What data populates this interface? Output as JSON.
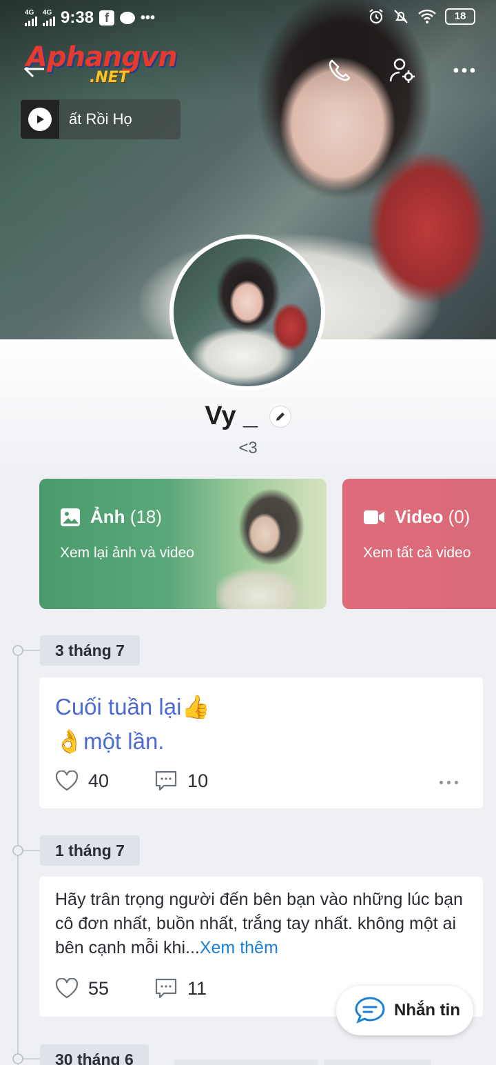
{
  "status_bar": {
    "network1": "4G",
    "network2": "4G",
    "time": "9:38",
    "battery": "18"
  },
  "watermark": {
    "brand_main": "Aphangvn",
    "brand_sub": ".NET"
  },
  "music": {
    "text": "ất Rồi     Họ"
  },
  "profile": {
    "name": "Vy _",
    "status": "<3"
  },
  "media": {
    "photo": {
      "label": "Ảnh",
      "count": "(18)",
      "subtitle": "Xem lại ảnh và video"
    },
    "video": {
      "label": "Video",
      "count": "(0)",
      "subtitle": "Xem tất cả video"
    }
  },
  "posts": [
    {
      "date": "3 tháng 7",
      "line1": "Cuối tuần lại👍",
      "line2": "👌một lần.",
      "likes": "40",
      "comments": "10"
    },
    {
      "date": "1 tháng 7",
      "text": "Hãy trân trọng người đến bên bạn vào những lúc bạn cô đơn nhất, buồn nhất, trắng tay nhất. không một ai bên cạnh mỗi khi...",
      "more": "Xem thêm",
      "likes": "55",
      "comments": "11"
    }
  ],
  "next_date": "30 tháng 6",
  "message_button": "Nhắn tin",
  "icons": {
    "back": "back-arrow-icon",
    "call": "phone-icon",
    "profile_settings": "user-gear-icon",
    "more": "more-dots-icon",
    "photo": "image-icon",
    "video": "video-camera-icon",
    "like": "heart-icon",
    "comment": "comment-icon",
    "message": "chat-bubble-icon",
    "edit": "pencil-icon"
  },
  "colors": {
    "photo_card": "#4a9b6c",
    "video_card": "#df6b7b",
    "link": "#1a7fd6",
    "post_colored_text": "#4b6ad3"
  }
}
